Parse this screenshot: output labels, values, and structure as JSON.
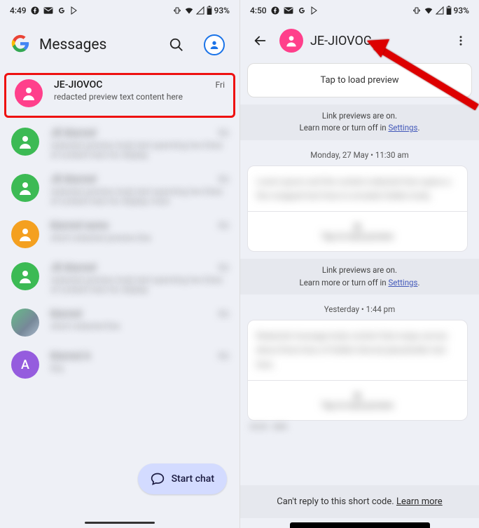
{
  "left": {
    "status": {
      "time": "4:49",
      "battery": "93%"
    },
    "app_title": "Messages",
    "fab_label": "Start chat",
    "conversations": [
      {
        "name": "JE-JIOVOC",
        "time": "Fri",
        "preview": "redacted preview text content here",
        "avatar": "pink",
        "highlighted": true
      },
      {
        "name": "JE-blurred",
        "time": "Fri",
        "preview": "redacted preview body text spanning two lines of content here for display",
        "avatar": "green"
      },
      {
        "name": "JE-blurred",
        "time": "Fri",
        "preview": "redacted preview body text spanning two lines of content here for display more",
        "avatar": "green"
      },
      {
        "name": "blurred name",
        "time": "Fri",
        "preview": "short redacted preview line",
        "avatar": "orange"
      },
      {
        "name": "JE-blurred",
        "time": "Fri",
        "preview": "redacted preview body text spanning two lines of content here for display",
        "avatar": "green"
      },
      {
        "name": "blurred",
        "time": "Fri",
        "preview": "short redacted line",
        "avatar": "photo"
      },
      {
        "name": "blurred A",
        "time": "Fri",
        "preview": "tiny",
        "avatar": "purple",
        "letter": "A",
        "badge": true
      }
    ]
  },
  "right": {
    "status": {
      "time": "4:50",
      "battery": "93%"
    },
    "chat_title": "JE-JIOVOC",
    "load_preview": "Tap to load preview",
    "link_preview_line1": "Link previews are on.",
    "link_preview_line2_prefix": "Learn more or turn off in ",
    "link_preview_link": "Settings",
    "timestamp1": "Monday, 27 May • 11:30 am",
    "timestamp2": "Yesterday • 1:44 pm",
    "footer_text": "Can't reply to this short code. ",
    "footer_link": "Learn more"
  }
}
